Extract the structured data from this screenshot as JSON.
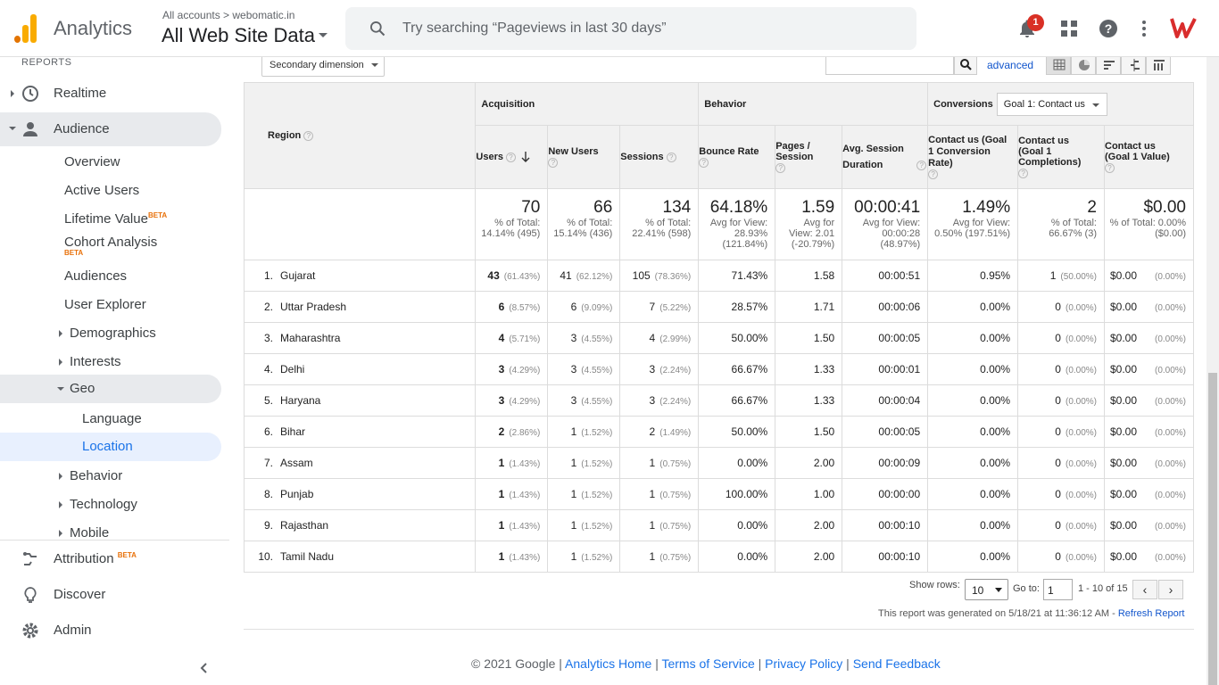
{
  "header": {
    "app_name": "Analytics",
    "breadcrumb_small": "All accounts > webomatic.in",
    "property": "All Web Site Data",
    "search_placeholder": "Try searching “Pageviews in last 30 days”",
    "notification_count": "1",
    "brand_color": "#f9ab00"
  },
  "sidebar": {
    "reports_label": "REPORTS",
    "realtime": "Realtime",
    "audience": "Audience",
    "overview": "Overview",
    "active_users": "Active Users",
    "lifetime_value": "Lifetime Value",
    "cohort_analysis": "Cohort Analysis",
    "beta": "BETA",
    "audiences": "Audiences",
    "user_explorer": "User Explorer",
    "demographics": "Demographics",
    "interests": "Interests",
    "geo": "Geo",
    "language": "Language",
    "location": "Location",
    "behavior": "Behavior",
    "technology": "Technology",
    "mobile": "Mobile",
    "attribution": "Attribution",
    "discover": "Discover",
    "admin": "Admin"
  },
  "toolbar": {
    "secondary_dimension": "Secondary dimension",
    "advanced": "advanced"
  },
  "table": {
    "region_header": "Region",
    "group_acquisition": "Acquisition",
    "group_behavior": "Behavior",
    "group_conversions": "Conversions",
    "goal_select": "Goal 1: Contact us",
    "columns": {
      "users": "Users",
      "new_users": "New Users",
      "sessions": "Sessions",
      "bounce_rate": "Bounce Rate",
      "pages_session": "Pages / Session",
      "avg_session": "Avg. Session Duration",
      "conv_rate": "Contact us (Goal 1 Conversion Rate)",
      "completions": "Contact us (Goal 1 Completions)",
      "value": "Contact us (Goal 1 Value)"
    },
    "totals": {
      "users": "70",
      "users_sub": "% of Total: 14.14% (495)",
      "new_users": "66",
      "new_users_sub": "% of Total: 15.14% (436)",
      "sessions": "134",
      "sessions_sub": "% of Total: 22.41% (598)",
      "bounce_rate": "64.18%",
      "bounce_rate_sub": "Avg for View: 28.93% (121.84%)",
      "pages_session": "1.59",
      "pages_session_sub": "Avg for View: 2.01 (-20.79%)",
      "avg_session": "00:00:41",
      "avg_session_sub": "Avg for View: 00:00:28 (48.97%)",
      "conv_rate": "1.49%",
      "conv_rate_sub": "Avg for View: 0.50% (197.51%)",
      "completions": "2",
      "completions_sub": "% of Total: 66.67% (3)",
      "value": "$0.00",
      "value_sub": "% of Total: 0.00% ($0.00)"
    },
    "rows": [
      {
        "idx": "1.",
        "region": "Gujarat",
        "users": "43",
        "users_pct": "(61.43%)",
        "new_users": "41",
        "new_users_pct": "(62.12%)",
        "sessions": "105",
        "sessions_pct": "(78.36%)",
        "bounce": "71.43%",
        "pages": "1.58",
        "duration": "00:00:51",
        "conv": "0.95%",
        "comp": "1",
        "comp_pct": "(50.00%)",
        "value": "$0.00",
        "value_pct": "(0.00%)"
      },
      {
        "idx": "2.",
        "region": "Uttar Pradesh",
        "users": "6",
        "users_pct": "(8.57%)",
        "new_users": "6",
        "new_users_pct": "(9.09%)",
        "sessions": "7",
        "sessions_pct": "(5.22%)",
        "bounce": "28.57%",
        "pages": "1.71",
        "duration": "00:00:06",
        "conv": "0.00%",
        "comp": "0",
        "comp_pct": "(0.00%)",
        "value": "$0.00",
        "value_pct": "(0.00%)"
      },
      {
        "idx": "3.",
        "region": "Maharashtra",
        "users": "4",
        "users_pct": "(5.71%)",
        "new_users": "3",
        "new_users_pct": "(4.55%)",
        "sessions": "4",
        "sessions_pct": "(2.99%)",
        "bounce": "50.00%",
        "pages": "1.50",
        "duration": "00:00:05",
        "conv": "0.00%",
        "comp": "0",
        "comp_pct": "(0.00%)",
        "value": "$0.00",
        "value_pct": "(0.00%)"
      },
      {
        "idx": "4.",
        "region": "Delhi",
        "users": "3",
        "users_pct": "(4.29%)",
        "new_users": "3",
        "new_users_pct": "(4.55%)",
        "sessions": "3",
        "sessions_pct": "(2.24%)",
        "bounce": "66.67%",
        "pages": "1.33",
        "duration": "00:00:01",
        "conv": "0.00%",
        "comp": "0",
        "comp_pct": "(0.00%)",
        "value": "$0.00",
        "value_pct": "(0.00%)"
      },
      {
        "idx": "5.",
        "region": "Haryana",
        "users": "3",
        "users_pct": "(4.29%)",
        "new_users": "3",
        "new_users_pct": "(4.55%)",
        "sessions": "3",
        "sessions_pct": "(2.24%)",
        "bounce": "66.67%",
        "pages": "1.33",
        "duration": "00:00:04",
        "conv": "0.00%",
        "comp": "0",
        "comp_pct": "(0.00%)",
        "value": "$0.00",
        "value_pct": "(0.00%)"
      },
      {
        "idx": "6.",
        "region": "Bihar",
        "users": "2",
        "users_pct": "(2.86%)",
        "new_users": "1",
        "new_users_pct": "(1.52%)",
        "sessions": "2",
        "sessions_pct": "(1.49%)",
        "bounce": "50.00%",
        "pages": "1.50",
        "duration": "00:00:05",
        "conv": "0.00%",
        "comp": "0",
        "comp_pct": "(0.00%)",
        "value": "$0.00",
        "value_pct": "(0.00%)"
      },
      {
        "idx": "7.",
        "region": "Assam",
        "users": "1",
        "users_pct": "(1.43%)",
        "new_users": "1",
        "new_users_pct": "(1.52%)",
        "sessions": "1",
        "sessions_pct": "(0.75%)",
        "bounce": "0.00%",
        "pages": "2.00",
        "duration": "00:00:09",
        "conv": "0.00%",
        "comp": "0",
        "comp_pct": "(0.00%)",
        "value": "$0.00",
        "value_pct": "(0.00%)"
      },
      {
        "idx": "8.",
        "region": "Punjab",
        "users": "1",
        "users_pct": "(1.43%)",
        "new_users": "1",
        "new_users_pct": "(1.52%)",
        "sessions": "1",
        "sessions_pct": "(0.75%)",
        "bounce": "100.00%",
        "pages": "1.00",
        "duration": "00:00:00",
        "conv": "0.00%",
        "comp": "0",
        "comp_pct": "(0.00%)",
        "value": "$0.00",
        "value_pct": "(0.00%)"
      },
      {
        "idx": "9.",
        "region": "Rajasthan",
        "users": "1",
        "users_pct": "(1.43%)",
        "new_users": "1",
        "new_users_pct": "(1.52%)",
        "sessions": "1",
        "sessions_pct": "(0.75%)",
        "bounce": "0.00%",
        "pages": "2.00",
        "duration": "00:00:10",
        "conv": "0.00%",
        "comp": "0",
        "comp_pct": "(0.00%)",
        "value": "$0.00",
        "value_pct": "(0.00%)"
      },
      {
        "idx": "10.",
        "region": "Tamil Nadu",
        "users": "1",
        "users_pct": "(1.43%)",
        "new_users": "1",
        "new_users_pct": "(1.52%)",
        "sessions": "1",
        "sessions_pct": "(0.75%)",
        "bounce": "0.00%",
        "pages": "2.00",
        "duration": "00:00:10",
        "conv": "0.00%",
        "comp": "0",
        "comp_pct": "(0.00%)",
        "value": "$0.00",
        "value_pct": "(0.00%)"
      }
    ]
  },
  "pager": {
    "show_rows_label": "Show rows:",
    "show_rows_value": "10",
    "goto_label": "Go to:",
    "goto_value": "1",
    "range": "1 - 10 of 15",
    "prev": "‹",
    "next": "›"
  },
  "generated": {
    "text": "This report was generated on 5/18/21 at 11:36:12 AM - ",
    "refresh": "Refresh Report"
  },
  "footer": {
    "copyright": "© 2021 Google",
    "sep": " | ",
    "analytics_home": "Analytics Home",
    "terms": "Terms of Service",
    "privacy": "Privacy Policy",
    "feedback": "Send Feedback"
  }
}
